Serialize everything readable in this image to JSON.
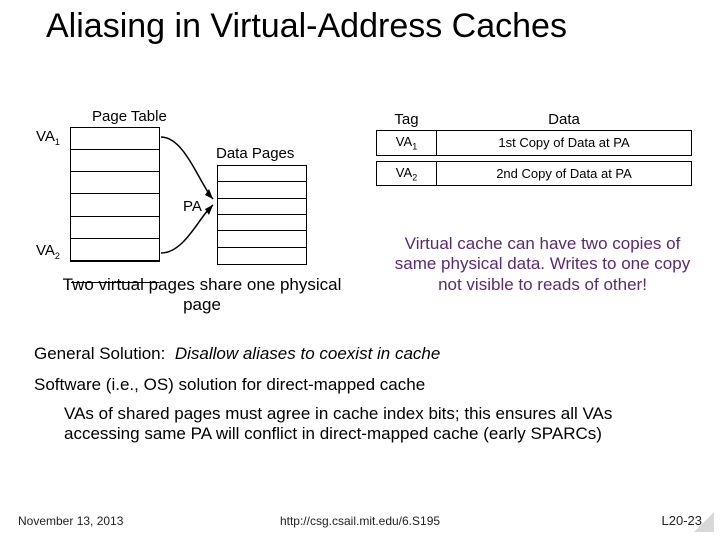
{
  "title": "Aliasing in Virtual-Address Caches",
  "labels": {
    "page_table": "Page Table",
    "va1": "VA",
    "va1_sub": "1",
    "va2": "VA",
    "va2_sub": "2",
    "data_pages": "Data Pages",
    "pa": "PA"
  },
  "cache": {
    "headers": {
      "tag": "Tag",
      "data": "Data"
    },
    "rows": [
      {
        "tag": "VA",
        "tag_sub": "1",
        "data": "1st Copy of Data at PA"
      },
      {
        "tag": "VA",
        "tag_sub": "2",
        "data": "2nd Copy of Data at PA"
      }
    ]
  },
  "two_share": "Two virtual pages share one physical page",
  "virt_body": "Virtual cache can have two copies of same physical data. Writes to one copy not visible to reads of other!",
  "general_solution_label": "General Solution:",
  "general_solution_text": "Disallow aliases to coexist in cache",
  "software_solution": "Software (i.e., OS) solution for direct-mapped cache",
  "vas_text": "VAs of shared pages must agree in cache index bits; this ensures all VAs accessing same PA will conflict in direct-mapped cache (early SPARCs)",
  "footer": {
    "date": "November 13, 2013",
    "url": "http://csg.csail.mit.edu/6.S195",
    "slide": "L20-23"
  }
}
